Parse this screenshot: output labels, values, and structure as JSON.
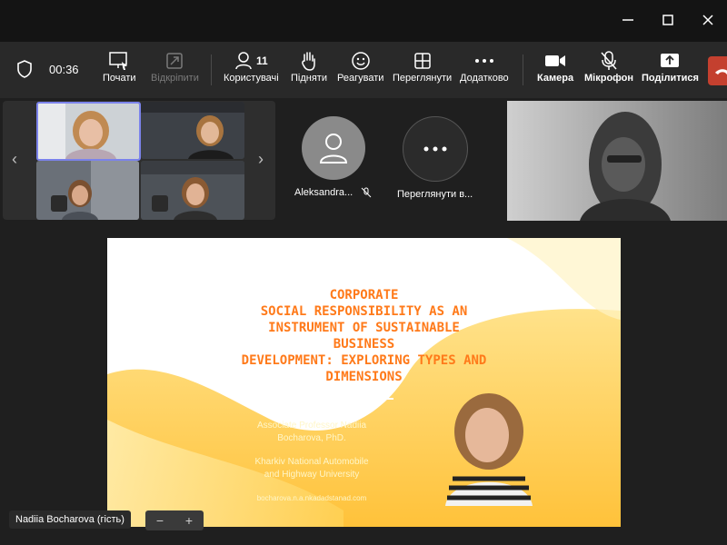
{
  "toolbar": {
    "timer": "00:36",
    "items": [
      {
        "label": "Почати",
        "icon": "record-icon"
      },
      {
        "label": "Відкріпити",
        "icon": "unpin-icon"
      },
      {
        "label": "Користувачі",
        "icon": "people-icon",
        "count": "11"
      },
      {
        "label": "Підняти",
        "icon": "raise-hand-icon"
      },
      {
        "label": "Реагувати",
        "icon": "react-icon"
      },
      {
        "label": "Переглянути",
        "icon": "view-icon"
      },
      {
        "label": "Додатково",
        "icon": "more-icon"
      },
      {
        "label": "Камера",
        "icon": "camera-icon"
      },
      {
        "label": "Мікрофон",
        "icon": "mic-off-icon"
      },
      {
        "label": "Поділитися",
        "icon": "share-icon"
      }
    ]
  },
  "participants": {
    "tile1_label": "Aleksandra...",
    "tile2_label": "Переглянути в..."
  },
  "slide": {
    "title_lines": [
      "CORPORATE",
      "SOCIAL RESPONSIBILITY AS AN",
      "INSTRUMENT OF SUSTAINABLE",
      "BUSINESS",
      "DEVELOPMENT: EXPLORING TYPES AND",
      "DIMENSIONS"
    ],
    "author_line1": "Associate Professor Nadiia",
    "author_line2": "Bocharova, PhD.",
    "univ_line1": "Kharkiv National Automobile",
    "univ_line2": "and Highway University",
    "email": "bocharova.n.a.nkadadstanad.com"
  },
  "presenter_name": "Nadiia Bocharova (гість)",
  "colors": {
    "accent": "#ff7a1a",
    "leave": "#c4402f"
  }
}
